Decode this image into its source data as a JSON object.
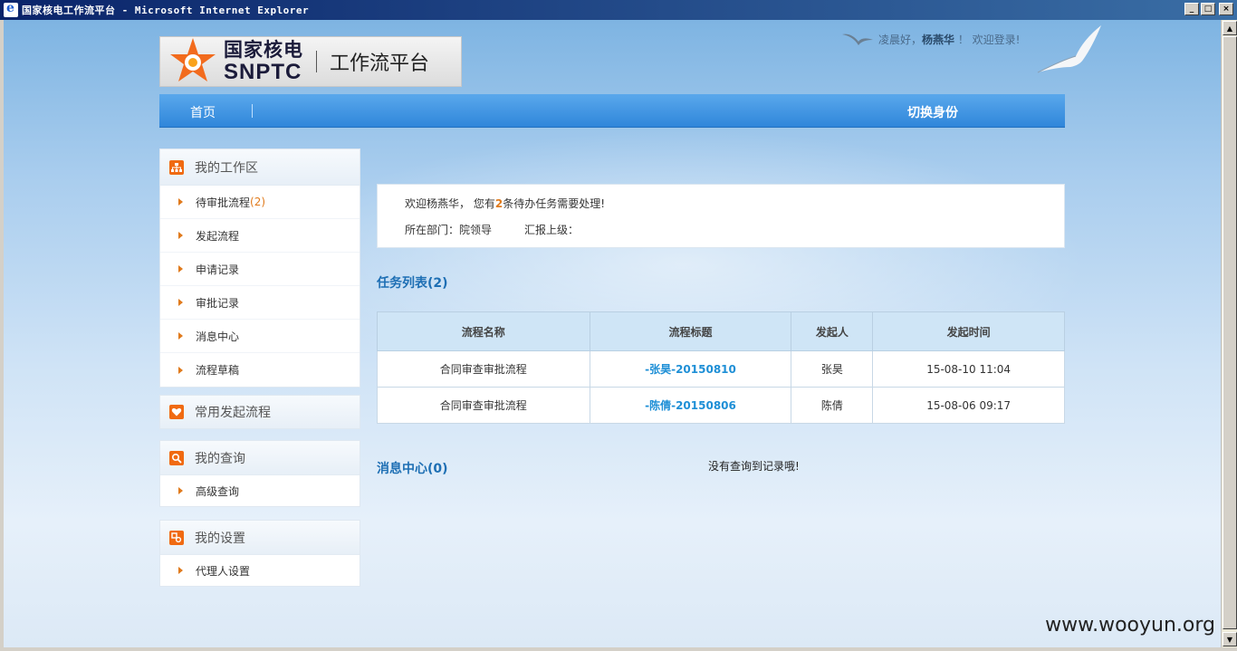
{
  "window": {
    "title": "国家核电工作流平台 - Microsoft Internet Explorer",
    "minimize": "_",
    "maximize": "□",
    "close": "×"
  },
  "header": {
    "logo_cn": "国家核电",
    "logo_en": "SNPTC",
    "platform": "工作流平台",
    "greeting_prefix": "凌晨好，",
    "greeting_user": "杨燕华",
    "greeting_suffix": " ！ 欢迎登录!"
  },
  "nav": {
    "home": "首页",
    "switch_identity": "切换身份"
  },
  "sidebar": {
    "workspace": {
      "title": "我的工作区",
      "items": [
        {
          "label": "待审批流程",
          "count": "(2)"
        },
        {
          "label": "发起流程"
        },
        {
          "label": "申请记录"
        },
        {
          "label": "审批记录"
        },
        {
          "label": "消息中心"
        },
        {
          "label": "流程草稿"
        }
      ]
    },
    "common": {
      "title": "常用发起流程"
    },
    "query": {
      "title": "我的查询",
      "items": [
        {
          "label": "高级查询"
        }
      ]
    },
    "settings": {
      "title": "我的设置",
      "items": [
        {
          "label": "代理人设置"
        }
      ]
    }
  },
  "welcome": {
    "prefix": "欢迎杨燕华， 您有",
    "count": "2",
    "suffix": "条待办任务需要处理!",
    "dept_label": "所在部门：院领导",
    "report_label": "汇报上级："
  },
  "tasks": {
    "title": "任务列表(2)",
    "columns": [
      "流程名称",
      "流程标题",
      "发起人",
      "发起时间"
    ],
    "rows": [
      [
        "合同审查审批流程",
        "-张昊-20150810",
        "张昊",
        "15-08-10 11:04"
      ],
      [
        "合同审查审批流程",
        "-陈倩-20150806",
        "陈倩",
        "15-08-06 09:17"
      ]
    ]
  },
  "messages": {
    "title": "消息中心(0)",
    "empty": "没有查询到记录哦!"
  },
  "watermark": "www.wooyun.org"
}
